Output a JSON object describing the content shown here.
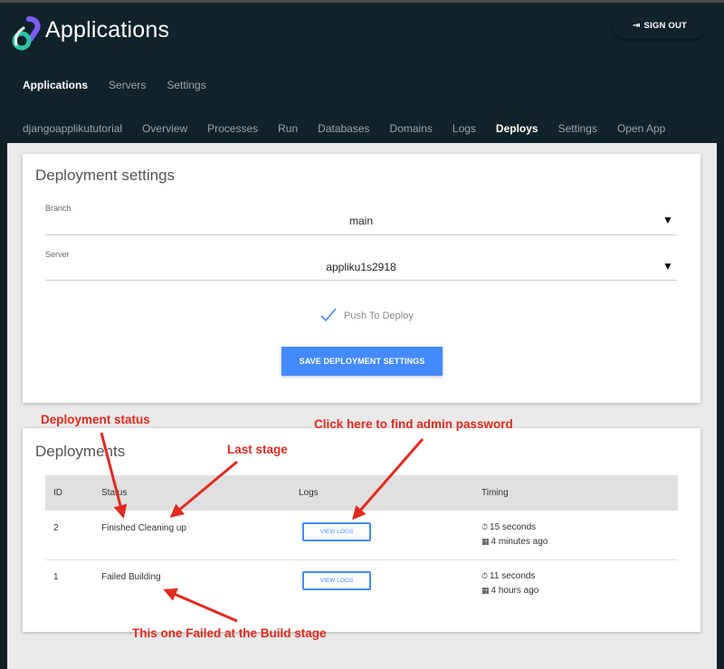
{
  "header": {
    "title": "Applications",
    "signout_label": "SIGN OUT",
    "signout_icon": "sign-out-icon"
  },
  "mainnav": [
    {
      "label": "Applications",
      "active": true
    },
    {
      "label": "Servers",
      "active": false
    },
    {
      "label": "Settings",
      "active": false
    }
  ],
  "subnav": [
    {
      "label": "djangoapplikututorial",
      "active": false
    },
    {
      "label": "Overview",
      "active": false
    },
    {
      "label": "Processes",
      "active": false
    },
    {
      "label": "Run",
      "active": false
    },
    {
      "label": "Databases",
      "active": false
    },
    {
      "label": "Domains",
      "active": false
    },
    {
      "label": "Logs",
      "active": false
    },
    {
      "label": "Deploys",
      "active": true
    },
    {
      "label": "Settings",
      "active": false
    },
    {
      "label": "Open App",
      "active": false
    }
  ],
  "deployment_settings": {
    "title": "Deployment settings",
    "branch_label": "Branch",
    "branch_value": "main",
    "server_label": "Server",
    "server_value": "appliku1s2918",
    "push_to_deploy_label": "Push To Deploy",
    "push_to_deploy_checked": true,
    "save_label": "SAVE DEPLOYMENT SETTINGS"
  },
  "deployments": {
    "title": "Deployments",
    "columns": [
      "ID",
      "Status",
      "Logs",
      "Timing"
    ],
    "rows": [
      {
        "id": "2",
        "status": "Finished Cleaning up",
        "logs_label": "VIEW LOGS",
        "duration": "15 seconds",
        "ago": "4 minutes ago"
      },
      {
        "id": "1",
        "status": "Failed Building",
        "logs_label": "VIEW LOGS",
        "duration": "11 seconds",
        "ago": "4 hours ago"
      }
    ]
  },
  "annotations": {
    "deployment_status": "Deployment status",
    "last_stage": "Last stage",
    "admin_password": "Click here to find admin password",
    "failed_build": "This one Failed at the Build stage"
  },
  "colors": {
    "header_bg": "#10232a",
    "accent": "#448aff",
    "annotation": "#e02b20"
  }
}
